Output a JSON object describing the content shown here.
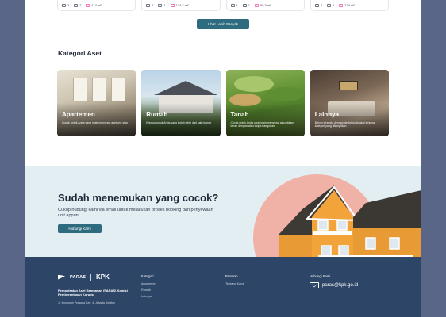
{
  "listings": [
    {
      "beds": "3",
      "baths": "2",
      "area": "114 m²"
    },
    {
      "beds": "1",
      "baths": "1",
      "area": "124,7 m²"
    },
    {
      "beds": "1",
      "baths": "1",
      "area": "58,3 m²"
    },
    {
      "beds": "3",
      "baths": "2",
      "area": "134 m²"
    }
  ],
  "more_button": "Lihat Lebih Banyak",
  "categories_title": "Kategori Aset",
  "categories": [
    {
      "name": "Apartemen",
      "desc": "Cocok untuk Anda yang ingin menyewa aset unit siap"
    },
    {
      "name": "Rumah",
      "desc": "Khusus untuk Anda yang butuh lebih dari satu kamar"
    },
    {
      "name": "Tanah",
      "desc": "Cocok untuk Anda yang ingin menyewa atau bidang tanah dengan atau tanpa bangunan"
    },
    {
      "name": "Lainnya",
      "desc": "Belum tersedia dengan deskripsi singkat tentang kategori yang ditampilkan"
    }
  ],
  "cta": {
    "title": "Sudah menemukan yang cocok?",
    "text": "Cukup hubungi kami via email untuk melakukan proses booking dan penyewaan unit appun.",
    "button": "Hubungi Kami"
  },
  "footer": {
    "brand_left": "PARAS",
    "brand_right": "KPK",
    "org": "Pemanfaatan Aset Rampasan (PARAS) Komisi Pemberantasan Korupsi",
    "address": "Jl. Kuningan Persada Kav. 4, Jakarta Selatan",
    "col1_title": "Kategori",
    "col1_links": [
      "Apartemen",
      "Rumah",
      "Lainnya"
    ],
    "col2_title": "Bantuan",
    "col2_links": [
      "Tentang Kami"
    ],
    "col3_title": "Hubungi Kami",
    "email": "paras@kpk.go.id"
  },
  "colors": {
    "primary": "#2f6b7f",
    "footer": "#2d4567",
    "cta_bg": "#e3eef3",
    "blob": "#f0b1a6"
  }
}
